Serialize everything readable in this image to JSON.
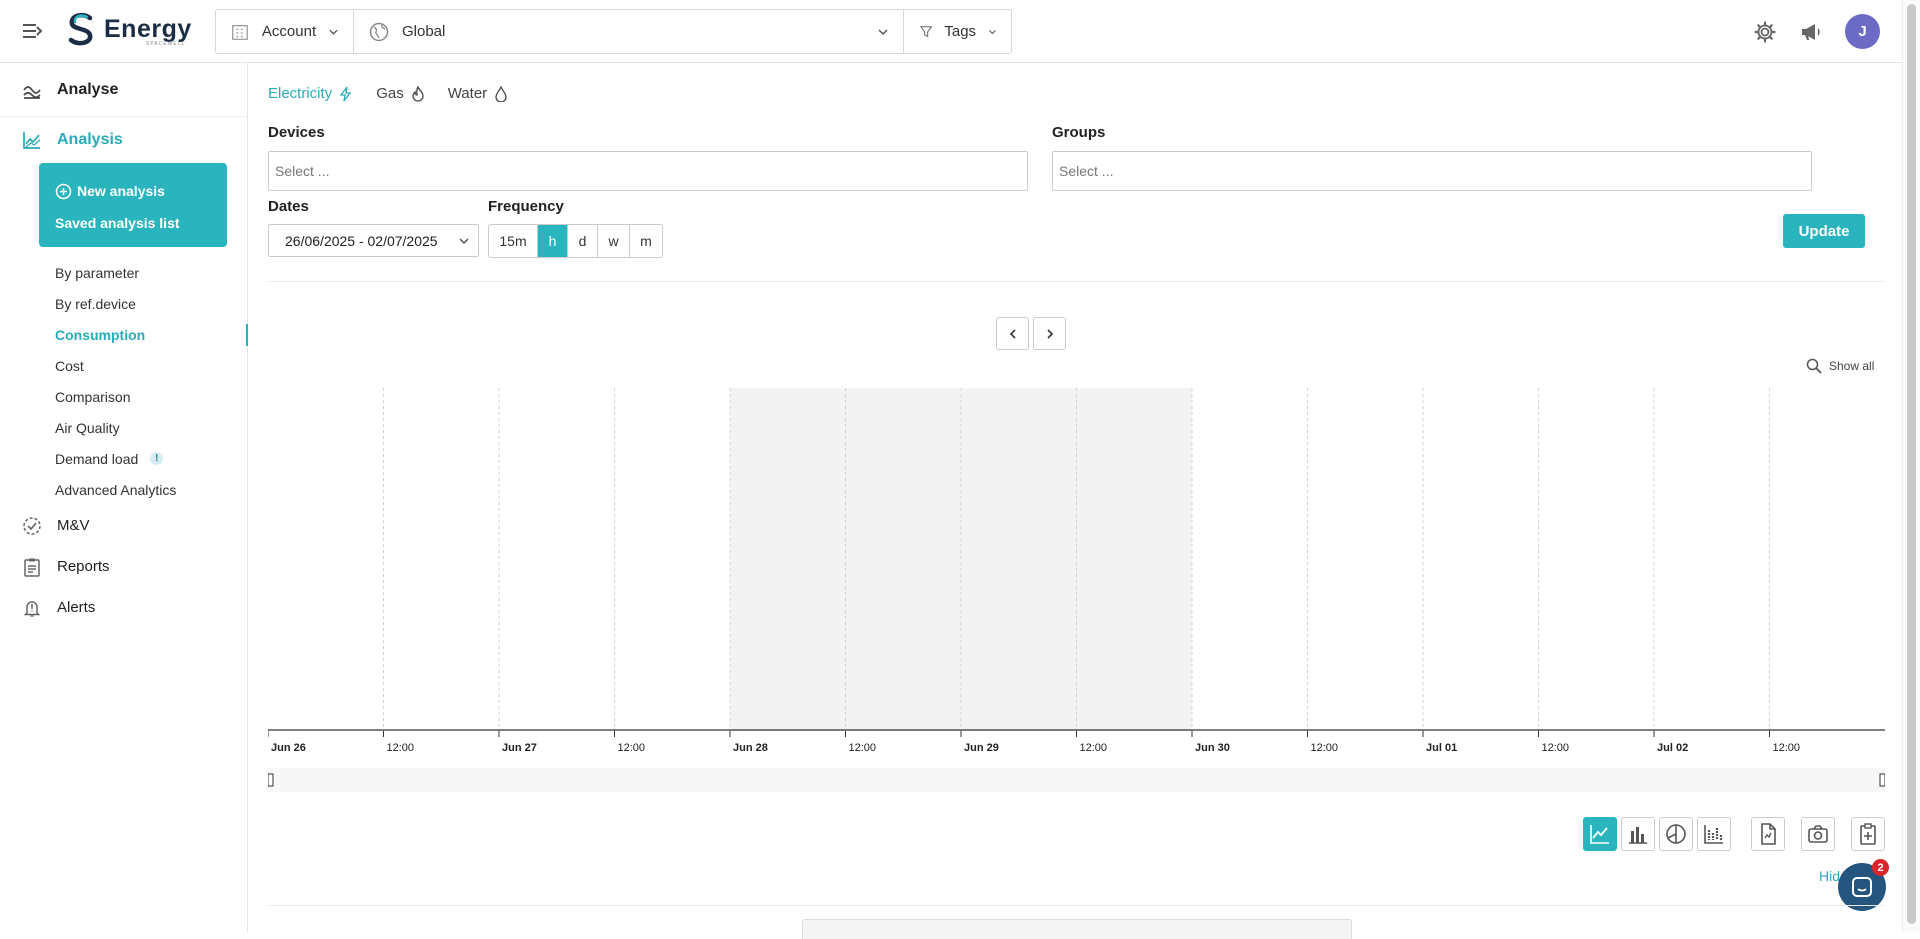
{
  "header": {
    "logo_text": "Energy",
    "logo_sub": "SPACEWELL",
    "account_label": "Account",
    "scope_label": "Global",
    "tags_label": "Tags",
    "avatar_initial": "J"
  },
  "sidebar": {
    "analyse_label": "Analyse",
    "analysis_label": "Analysis",
    "new_analysis_label": "New analysis",
    "saved_list_label": "Saved analysis list",
    "sub_items": [
      {
        "label": "By parameter"
      },
      {
        "label": "By ref.device"
      },
      {
        "label": "Consumption",
        "active": true
      },
      {
        "label": "Cost"
      },
      {
        "label": "Comparison"
      },
      {
        "label": "Air Quality"
      },
      {
        "label": "Demand load",
        "badge": "!"
      },
      {
        "label": "Advanced Analytics"
      }
    ],
    "main_items": [
      {
        "label": "M&V",
        "icon": "check-circle-icon"
      },
      {
        "label": "Reports",
        "icon": "clipboard-icon"
      },
      {
        "label": "Alerts",
        "icon": "bell-icon"
      }
    ]
  },
  "main": {
    "energy_tabs": [
      {
        "label": "Electricity",
        "icon": "bolt-icon",
        "active": true
      },
      {
        "label": "Gas",
        "icon": "flame-icon"
      },
      {
        "label": "Water",
        "icon": "drop-icon"
      }
    ],
    "devices_label": "Devices",
    "devices_placeholder": "Select ...",
    "groups_label": "Groups",
    "groups_placeholder": "Select ...",
    "dates_label": "Dates",
    "date_range": "26/06/2025 - 02/07/2025",
    "frequency_label": "Frequency",
    "frequency_options": [
      "15m",
      "h",
      "d",
      "w",
      "m"
    ],
    "frequency_selected": "h",
    "update_label": "Update",
    "show_all_label": "Show all",
    "hide_label": "Hid",
    "chat_count": "2"
  },
  "chart_data": {
    "type": "line",
    "x_tick_labels": [
      "Jun 26",
      "12:00",
      "Jun 27",
      "12:00",
      "Jun 28",
      "12:00",
      "Jun 29",
      "12:00",
      "Jun 30",
      "12:00",
      "Jul 01",
      "12:00",
      "Jul 02",
      "12:00"
    ],
    "major_ticks": [
      "Jun 26",
      "Jun 27",
      "Jun 28",
      "Jun 29",
      "Jun 30",
      "Jul 01",
      "Jul 02"
    ],
    "shaded_range": [
      "Jun 28",
      "Jun 30"
    ],
    "series": [],
    "grid": true,
    "colors": {
      "accent": "#2ab5be",
      "grid": "#d0d0d0",
      "shade": "#f3f3f3"
    }
  },
  "colors": {
    "accent": "#2ab5be",
    "accent_text": "#2aabb8",
    "avatar": "#6b6bc6",
    "chat": "#24557e",
    "badge_red": "#d9242c"
  }
}
